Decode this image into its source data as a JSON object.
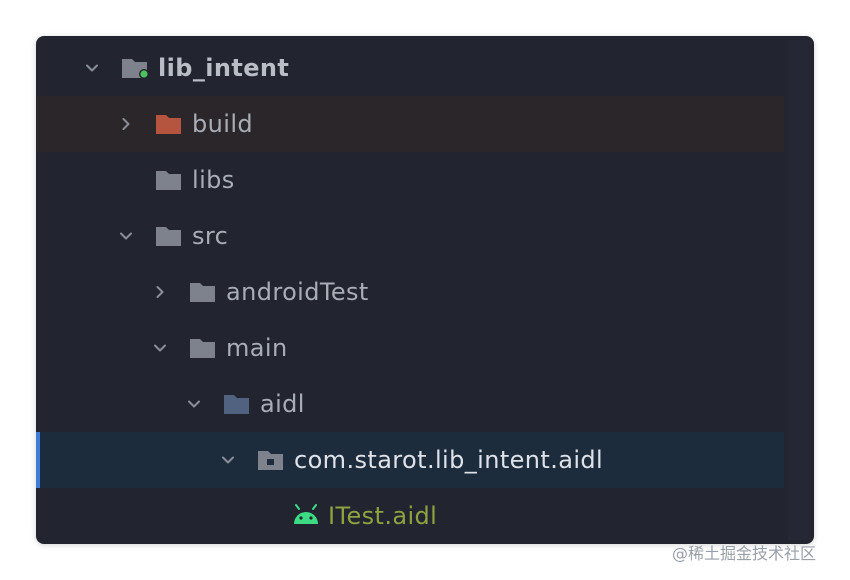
{
  "tree": {
    "root": {
      "label": "lib_intent"
    },
    "build": {
      "label": "build"
    },
    "libs": {
      "label": "libs"
    },
    "src": {
      "label": "src"
    },
    "android_test": {
      "label": "androidTest"
    },
    "main": {
      "label": "main"
    },
    "aidl": {
      "label": "aidl"
    },
    "package": {
      "label": "com.starot.lib_intent.aidl"
    },
    "file": {
      "label": "ITest.aidl"
    }
  },
  "icons": {
    "expanded": "chevron-down-icon",
    "collapsed": "chevron-right-icon",
    "folder": "folder-icon",
    "module": "module-folder-icon",
    "excluded": "excluded-folder-icon",
    "source_root": "source-folder-icon",
    "package": "package-folder-icon",
    "aidl_file": "android-icon"
  },
  "colors": {
    "background": "#222530",
    "selected_row": "#1d2c3d",
    "selection_bar": "#3f7ed8",
    "excluded_row": "#2a262a",
    "folder_gray": "#7d828c",
    "excluded_folder": "#b5543f",
    "source_folder": "#50627f",
    "module_dot": "#4cc05b",
    "android_green": "#3ddc84",
    "file_text": "#8ea23f"
  },
  "watermark": "@稀土掘金技术社区"
}
